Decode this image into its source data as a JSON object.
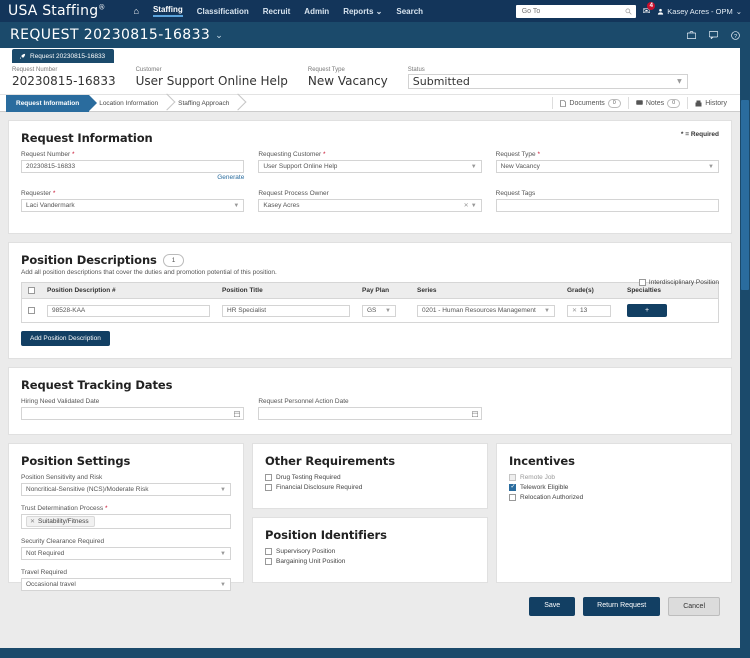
{
  "topnav": {
    "brand": "USA Staffing",
    "brand_sup": "®",
    "home_icon": "home-icon",
    "links": [
      {
        "label": "Staffing",
        "active": true
      },
      {
        "label": "Classification",
        "active": false
      },
      {
        "label": "Recruit",
        "active": false
      },
      {
        "label": "Admin",
        "active": false
      },
      {
        "label": "Reports",
        "active": false,
        "caret": true
      },
      {
        "label": "Search",
        "active": false
      }
    ],
    "goto_placeholder": "Go To",
    "goto_value": "",
    "mail_badge": "4",
    "user": "Kasey Acres - OPM"
  },
  "titlebar": {
    "title": "REQUEST 20230815-16833",
    "caret": "⌄",
    "icons": [
      "briefcase-icon",
      "chat-icon",
      "help-icon"
    ]
  },
  "request_tab": {
    "icon": "rocket-icon",
    "label": "Request 20230815-16833"
  },
  "summary": {
    "fields": [
      {
        "label": "Request Number",
        "value": "20230815-16833"
      },
      {
        "label": "Customer",
        "value": "User Support Online Help"
      },
      {
        "label": "Request Type",
        "value": "New Vacancy"
      }
    ],
    "status_label": "Status",
    "status_value": "Submitted"
  },
  "steps": [
    {
      "label": "Request Information",
      "active": true
    },
    {
      "label": "Location Information",
      "active": false
    },
    {
      "label": "Staffing Approach",
      "active": false
    }
  ],
  "doc_links": [
    {
      "icon": "document-icon",
      "label": "Documents",
      "count": "0"
    },
    {
      "icon": "note-icon",
      "label": "Notes",
      "count": "0"
    },
    {
      "icon": "history-icon",
      "label": "History",
      "count": ""
    }
  ],
  "request_information": {
    "heading": "Request Information",
    "required_note": "* = Required",
    "request_number_label": "Request Number",
    "request_number_value": "20230815-16833",
    "generate_link": "Generate",
    "requesting_customer_label": "Requesting Customer",
    "requesting_customer_value": "User Support Online Help",
    "request_type_label": "Request Type",
    "request_type_value": "New Vacancy",
    "requester_label": "Requester",
    "requester_value": "Laci Vandermark",
    "request_process_owner_label": "Request Process Owner",
    "request_process_owner_value": "Kasey Acres",
    "request_tags_label": "Request Tags",
    "request_tags_value": ""
  },
  "position_descriptions": {
    "heading": "Position Descriptions",
    "count": "1",
    "subtitle": "Add all position descriptions that cover the duties and promotion potential of this position.",
    "interdisciplinary_label": "Interdisciplinary Position",
    "interdisciplinary_checked": false,
    "columns": [
      "Position Description #",
      "Position Title",
      "Pay Plan",
      "Series",
      "Grade(s)",
      "Specialties"
    ],
    "rows": [
      {
        "pd_number": "98528-KAA",
        "position_title": "HR Specialist",
        "pay_plan": "GS",
        "series": "0201 - Human Resources Management",
        "grades": "13",
        "specialties_button": "+",
        "selected": false
      }
    ],
    "add_button": "Add Position Description"
  },
  "request_tracking_dates": {
    "heading": "Request Tracking Dates",
    "hiring_need_label": "Hiring Need Validated Date",
    "hiring_need_value": "",
    "personnel_action_label": "Request Personnel Action Date",
    "personnel_action_value": ""
  },
  "position_settings": {
    "heading": "Position Settings",
    "sensitivity_label": "Position Sensitivity and Risk",
    "sensitivity_value": "Noncritical-Sensitive (NCS)/Moderate Risk",
    "trust_label": "Trust Determination Process",
    "trust_tag": "Suitability/Fitness",
    "clearance_label": "Security Clearance Required",
    "clearance_value": "Not Required",
    "travel_label": "Travel Required",
    "travel_value": "Occasional travel"
  },
  "other_requirements": {
    "heading": "Other Requirements",
    "items": [
      {
        "label": "Drug Testing Required",
        "checked": false
      },
      {
        "label": "Financial Disclosure Required",
        "checked": false
      }
    ]
  },
  "position_identifiers": {
    "heading": "Position Identifiers",
    "items": [
      {
        "label": "Supervisory Position",
        "checked": false
      },
      {
        "label": "Bargaining Unit Position",
        "checked": false
      }
    ]
  },
  "incentives": {
    "heading": "Incentives",
    "items": [
      {
        "label": "Remote Job",
        "checked": false,
        "disabled": true
      },
      {
        "label": "Telework Eligible",
        "checked": true,
        "disabled": false
      },
      {
        "label": "Relocation Authorized",
        "checked": false,
        "disabled": false
      }
    ]
  },
  "footer": {
    "save": "Save",
    "return": "Return Request",
    "cancel": "Cancel"
  },
  "colors": {
    "header_dark": "#13355a",
    "header_blue": "#1b4a6b",
    "accent": "#2a6c9e",
    "button_navy": "#123f63",
    "required_red": "#c8102e"
  }
}
